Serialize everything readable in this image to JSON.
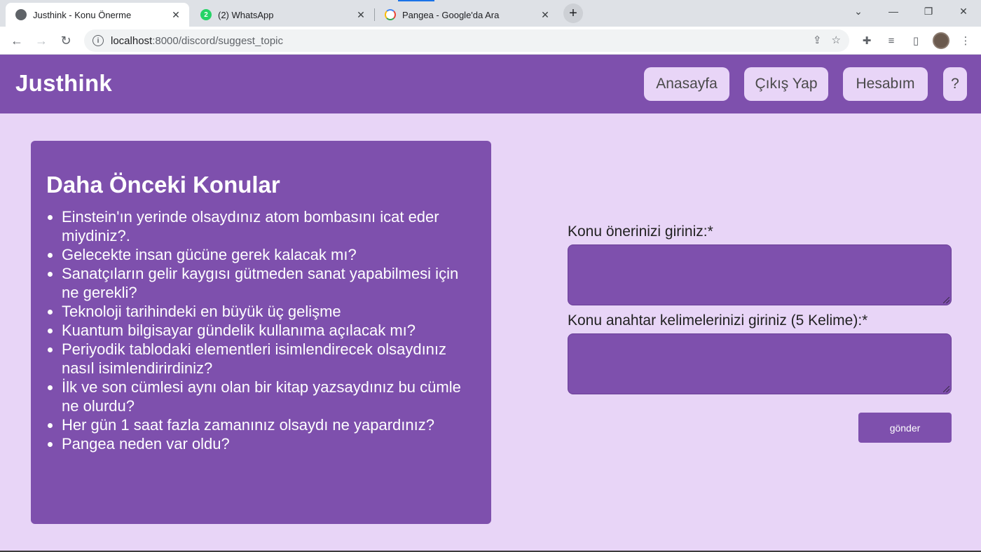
{
  "browser": {
    "tabs": [
      {
        "title": "Justhink - Konu Önerme",
        "icon": "globe-icon"
      },
      {
        "title": "(2) WhatsApp",
        "icon": "whatsapp-icon",
        "badge": "2"
      },
      {
        "title": "Pangea - Google'da Ara",
        "icon": "google-icon"
      }
    ],
    "url_host": "localhost",
    "url_rest": ":8000/discord/suggest_topic"
  },
  "header": {
    "brand": "Justhink",
    "nav": [
      "Anasayfa",
      "Çıkış Yap",
      "Hesabım",
      "?"
    ]
  },
  "previous_topics": {
    "title": "Daha Önceki Konular",
    "items": [
      "Einstein'ın yerinde olsaydınız atom bombasını icat eder miydiniz?.",
      "Gelecekte insan gücüne gerek kalacak mı?",
      "Sanatçıların gelir kaygısı gütmeden sanat yapabilmesi için ne gerekli?",
      "Teknoloji tarihindeki en büyük üç gelişme",
      "Kuantum bilgisayar gündelik kullanıma açılacak mı?",
      "Periyodik tablodaki elementleri isimlendirecek olsaydınız nasıl isimlendirirdiniz?",
      "İlk ve son cümlesi aynı olan bir kitap yazsaydınız bu cümle ne olurdu?",
      "Her gün 1 saat fazla zamanınız olsaydı ne yapardınız?",
      "Pangea neden var oldu?"
    ]
  },
  "form": {
    "topic_label": "Konu önerinizi giriniz:*",
    "keywords_label": "Konu anahtar kelimelerinizi giriniz (5 Kelime):*",
    "submit_label": "gönder"
  },
  "colors": {
    "primary": "#7e50ad",
    "background": "#e8d5f7"
  }
}
